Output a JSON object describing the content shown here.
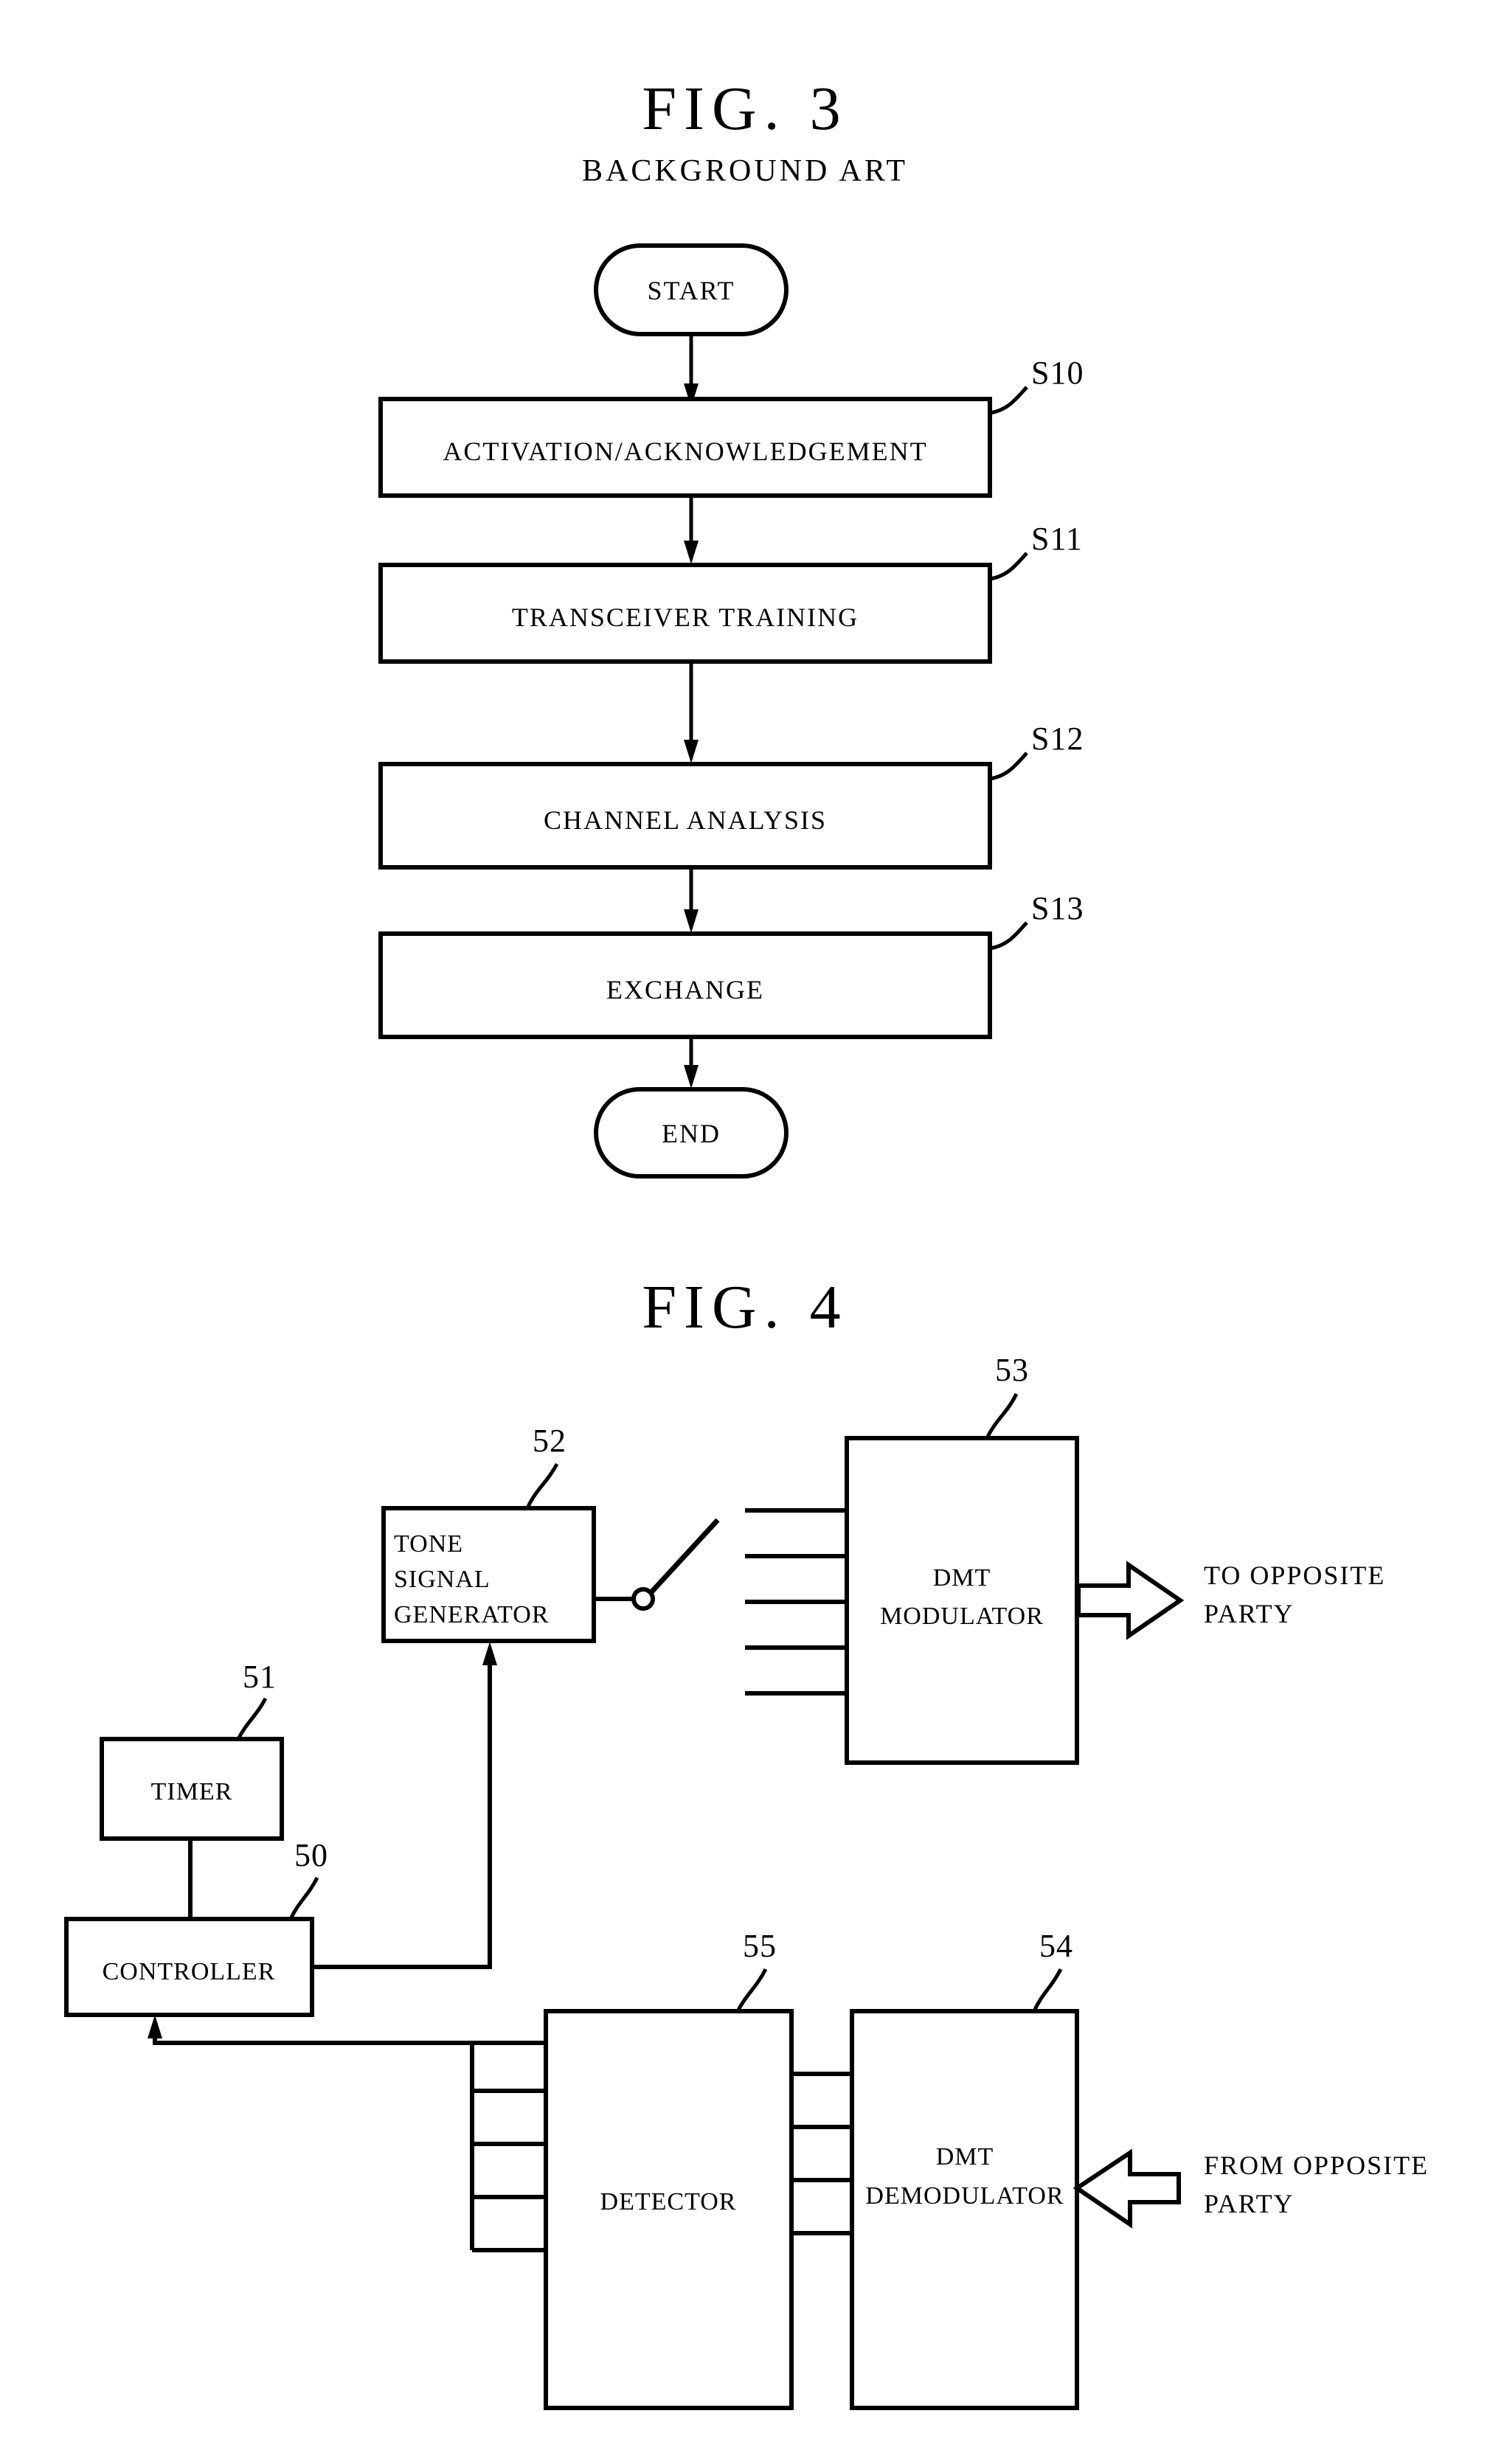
{
  "page": {
    "background_color": "#ffffff",
    "ink_color": "#000000",
    "document_type": "patent-drawing-sheet"
  },
  "figures": [
    {
      "id": "fig3",
      "title": "FIG. 3",
      "subtitle": "BACKGROUND ART",
      "kind": "flowchart",
      "nodes": [
        {
          "id": "start",
          "shape": "terminator",
          "label": "START",
          "ref": ""
        },
        {
          "id": "s10",
          "shape": "process",
          "label": "ACTIVATION/ACKNOWLEDGEMENT",
          "ref": "S10"
        },
        {
          "id": "s11",
          "shape": "process",
          "label": "TRANSCEIVER TRAINING",
          "ref": "S11"
        },
        {
          "id": "s12",
          "shape": "process",
          "label": "CHANNEL ANALYSIS",
          "ref": "S12"
        },
        {
          "id": "s13",
          "shape": "process",
          "label": "EXCHANGE",
          "ref": "S13"
        },
        {
          "id": "end",
          "shape": "terminator",
          "label": "END",
          "ref": ""
        }
      ],
      "edges": [
        {
          "from": "start",
          "to": "s10",
          "arrow": true
        },
        {
          "from": "s10",
          "to": "s11",
          "arrow": true
        },
        {
          "from": "s11",
          "to": "s12",
          "arrow": true
        },
        {
          "from": "s12",
          "to": "s13",
          "arrow": true
        },
        {
          "from": "s13",
          "to": "end",
          "arrow": true
        }
      ]
    },
    {
      "id": "fig4",
      "title": "FIG. 4",
      "subtitle": "",
      "kind": "block-diagram",
      "blocks": [
        {
          "id": "controller",
          "ref": "50",
          "lines": [
            "CONTROLLER"
          ]
        },
        {
          "id": "timer",
          "ref": "51",
          "lines": [
            "TIMER"
          ]
        },
        {
          "id": "tone",
          "ref": "52",
          "lines": [
            "TONE",
            "SIGNAL",
            "GENERATOR"
          ]
        },
        {
          "id": "mod",
          "ref": "53",
          "lines": [
            "DMT",
            "MODULATOR"
          ]
        },
        {
          "id": "demod",
          "ref": "54",
          "lines": [
            "DMT",
            "DEMODULATOR"
          ]
        },
        {
          "id": "detector",
          "ref": "55",
          "lines": [
            "DETECTOR"
          ]
        }
      ],
      "io_labels": [
        {
          "id": "to-opposite",
          "lines": [
            "TO OPPOSITE",
            "PARTY"
          ],
          "direction": "out"
        },
        {
          "id": "from-opposite",
          "lines": [
            "FROM OPPOSITE",
            "PARTY"
          ],
          "direction": "in"
        }
      ],
      "switch": {
        "id": "tone-switch",
        "state": "open"
      }
    }
  ]
}
